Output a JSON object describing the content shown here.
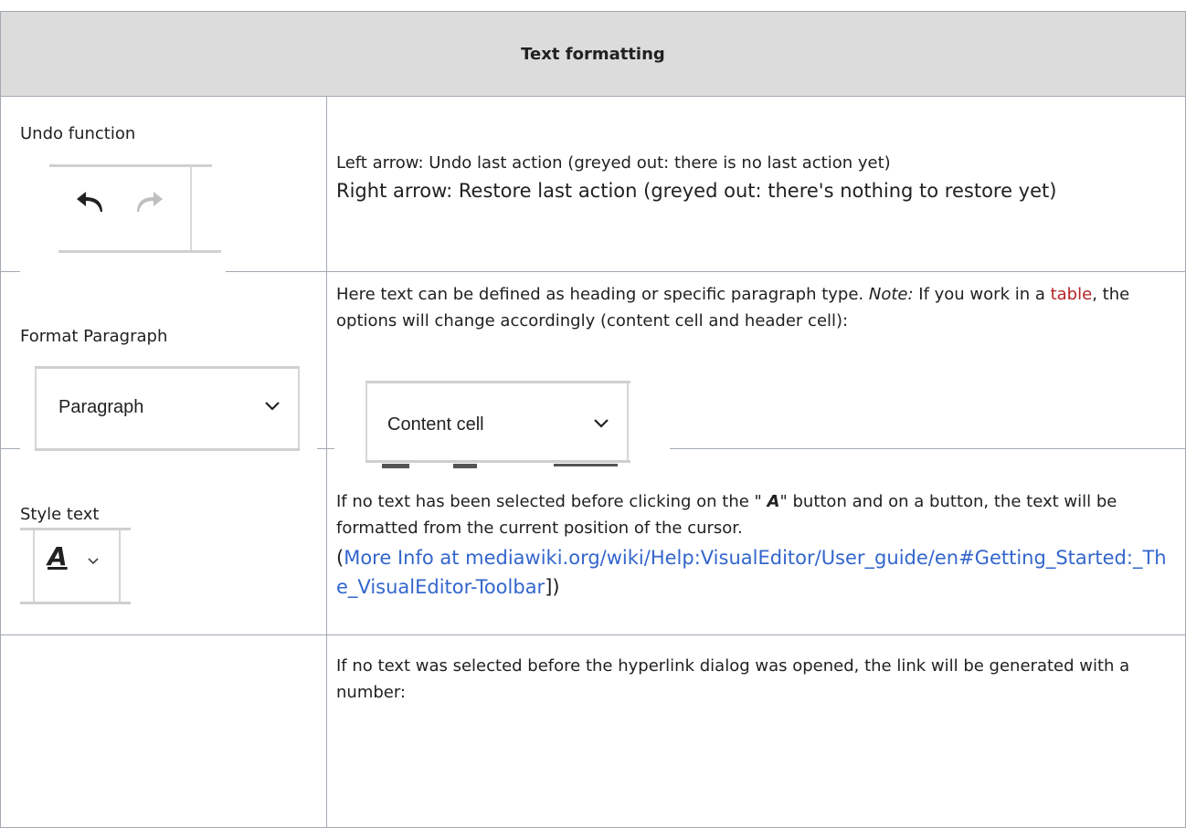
{
  "table": {
    "header": "Text formatting",
    "rows": [
      {
        "label": "Undo function",
        "desc_line1": "Left arrow: Undo last action (greyed out: there is no last action yet)",
        "desc_line2": "Right arrow: Restore last action (greyed out: there's nothing to restore yet)",
        "icons": [
          "undo-arrow-icon",
          "redo-arrow-icon"
        ],
        "undo_glyph": "↰",
        "redo_glyph": "➦"
      },
      {
        "label": "Format Paragraph",
        "desc_before_note": "Here text can be defined as heading or specific paragraph type. ",
        "note_label": "Note:",
        "desc_after_note": " If you work in a ",
        "link_text": "table",
        "desc_after_link": ", the options will change accordingly (content cell and header cell):",
        "dropdown_value": "Paragraph",
        "content_dropdown_value": "Content cell",
        "chevron": "⌵"
      },
      {
        "label": "Style text",
        "desc_before": "If no text has been selected before clicking on the \" ",
        "button_glyph": "A",
        "desc_after": "\" button and on a button, the text will be formatted from the current position of the cursor.",
        "paren_open": "(",
        "link_text": "More Info at mediawiki.org/wiki/Help:VisualEditor/User_guide/en#Getting_Started:_The_VisualEditor-Toolbar",
        "paren_close": "])"
      },
      {
        "label": "",
        "desc": "If no text was selected before the hyperlink dialog was opened, the link will be generated with a number:"
      }
    ]
  },
  "colors": {
    "header_bg": "#dcdcdc",
    "border": "#a2a9b1",
    "link_red": "#b32424",
    "link_blue": "#3366cc",
    "disabled_icon": "#bfbfbf"
  }
}
